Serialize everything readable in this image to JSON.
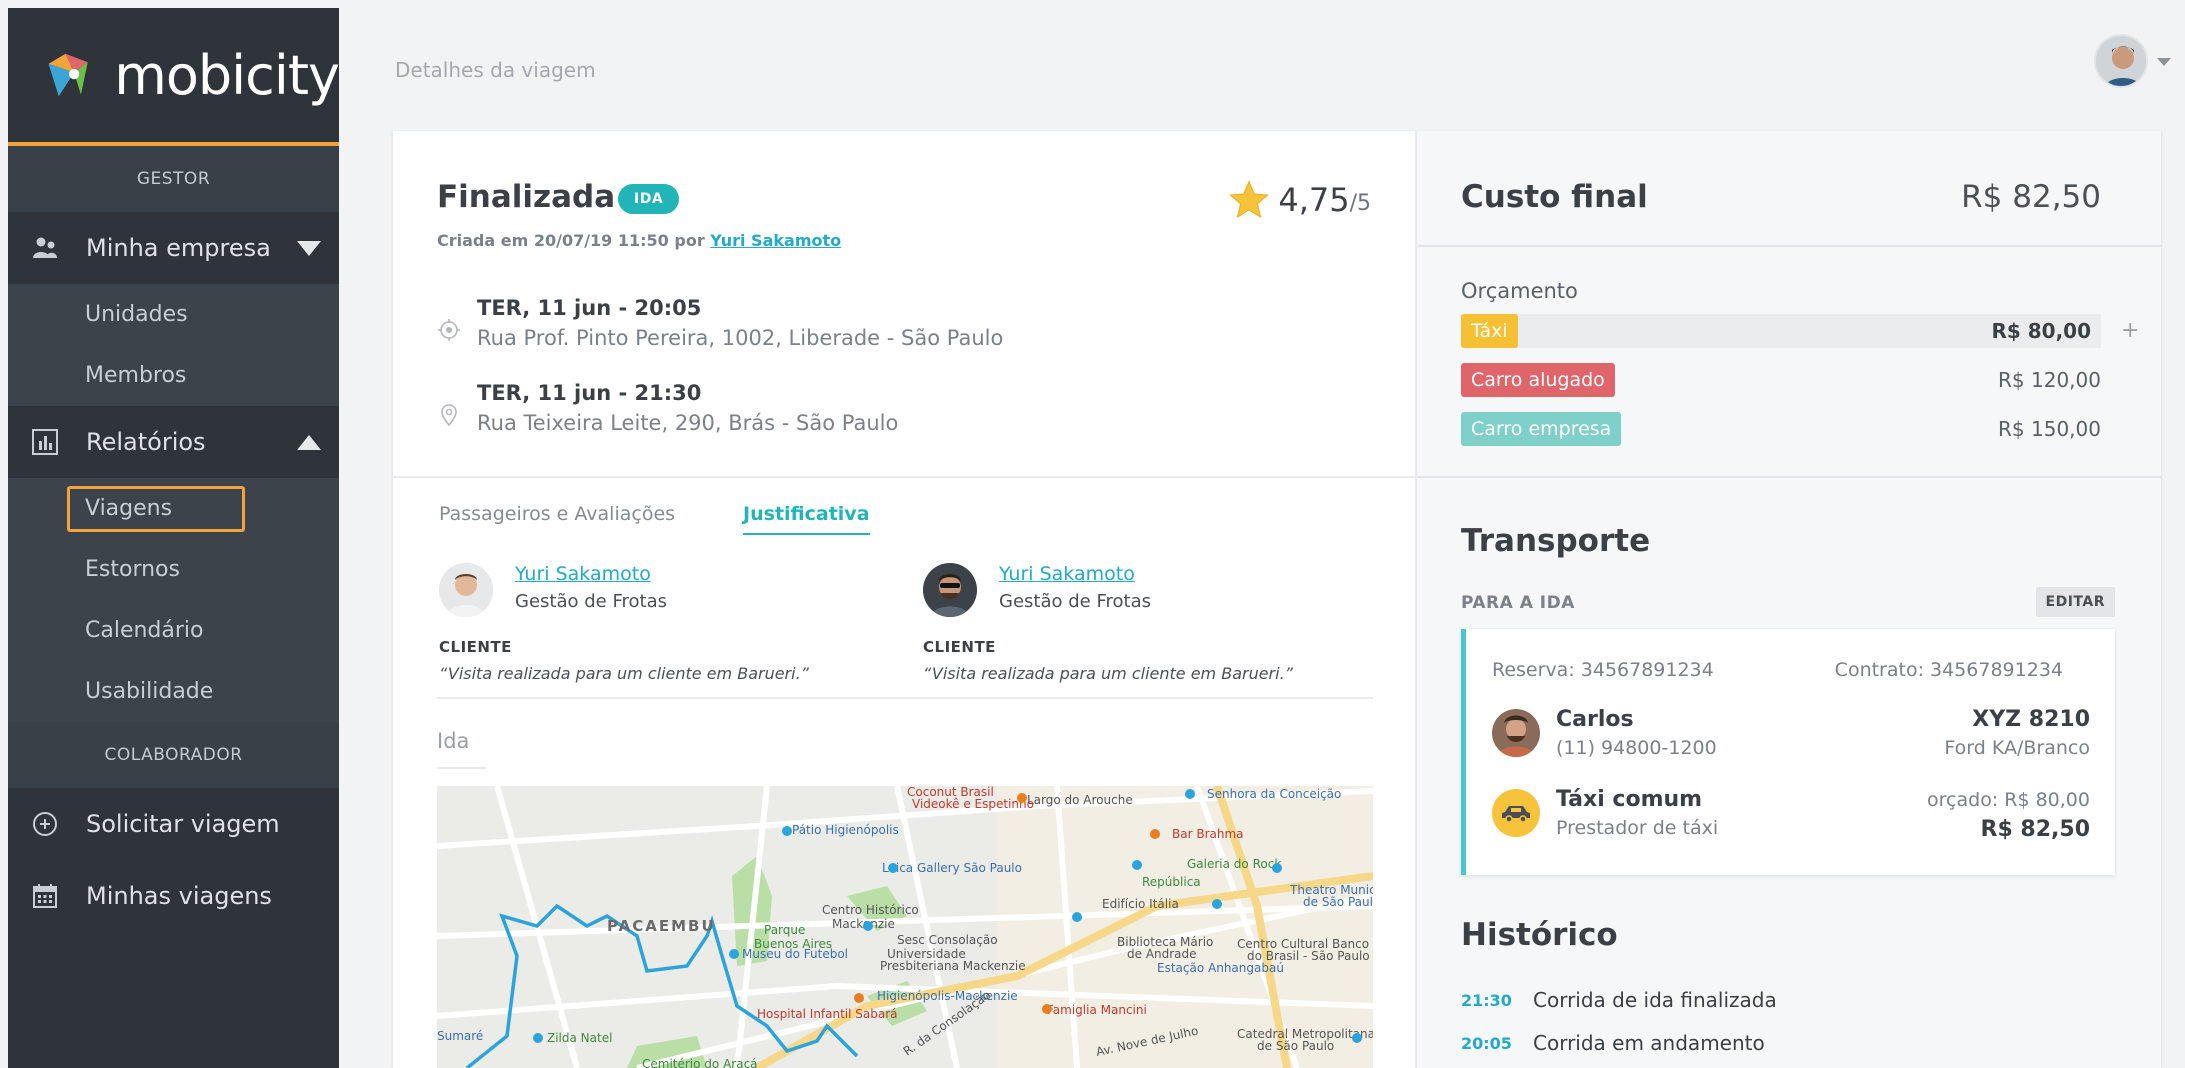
{
  "app": {
    "logo_text": "mobicity"
  },
  "sidebar": {
    "section_gestor": "GESTOR",
    "section_colaborador": "COLABORADOR",
    "empresa": {
      "label": "Minha empresa",
      "icon": "users-icon"
    },
    "empresa_items": [
      {
        "label": "Unidades"
      },
      {
        "label": "Membros"
      }
    ],
    "relatorios": {
      "label": "Relatórios",
      "icon": "chart-icon"
    },
    "relatorios_items": [
      {
        "label": "Viagens",
        "active": true
      },
      {
        "label": "Estornos"
      },
      {
        "label": "Calendário"
      },
      {
        "label": "Usabilidade"
      }
    ],
    "solicitar": {
      "label": "Solicitar viagem",
      "icon": "plus-circle-icon"
    },
    "minhas": {
      "label": "Minhas viagens",
      "icon": "calendar-icon"
    }
  },
  "header": {
    "title": "Detalhes da viagem"
  },
  "trip": {
    "status": "Finalizada",
    "badge": "IDA",
    "rating": "4,75",
    "rating_max": "/5",
    "created_prefix": "Criada em 20/07/19  11:50 por",
    "created_by": "Yuri Sakamoto",
    "origin": {
      "when": "TER, 11 jun - 20:05",
      "address": "Rua Prof. Pinto Pereira, 1002, Liberade - São Paulo"
    },
    "destination": {
      "when": "TER, 11 jun - 21:30",
      "address": "Rua Teixeira Leite, 290, Brás - São Paulo"
    },
    "tabs": [
      {
        "label": "Passageiros e Avaliações",
        "active": false
      },
      {
        "label": "Justificativa",
        "active": true
      }
    ],
    "passengers": [
      {
        "name": "Yuri Sakamoto",
        "role": "Gestão de Frotas",
        "client_label": "CLIENTE",
        "justification": "“Visita realizada para um cliente em Barueri.”"
      },
      {
        "name": "Yuri Sakamoto",
        "role": "Gestão de Frotas",
        "client_label": "CLIENTE",
        "justification": "“Visita realizada para um cliente em Barueri.”"
      }
    ],
    "route_label": "Ida",
    "map_labels": [
      "PACAEMBU",
      "Pátio Higienópolis",
      "Leica Gallery São Paulo",
      "Centro Histórico Mackenzie",
      "Parque Buenos Aires",
      "Museu do Futebol",
      "Sesc Consolação",
      "Universidade Presbiteriana Mackenzie",
      "Higienópolis-Mackenzie",
      "Hospital Infantil Sabará",
      "Cemitério do Araçá",
      "Zilda Natel",
      "Largo do Arouche",
      "Coconut Brasil Videokê e Espetinho",
      "Senhora da Conceição",
      "Bar Brahma",
      "Galeria do Rock",
      "República",
      "Theatro Municipal de São Paulo",
      "Edifício Itália",
      "Biblioteca Mário de Andrade",
      "Centro Cultural Banco do Brasil - São Paulo",
      "Estação Anhangabaú",
      "Famiglia Mancini",
      "Catedral Metropolitana de São Paulo",
      "Sumaré",
      "Av. Nove de Julho",
      "R. da Consolação"
    ]
  },
  "cost": {
    "title": "Custo final",
    "value": "R$ 82,50",
    "budget_label": "Orçamento",
    "budget": [
      {
        "tag": "Táxi",
        "amount": "R$ 80,00",
        "color": "#f5c033",
        "highlight": true
      },
      {
        "tag": "Carro alugado",
        "amount": "R$ 120,00",
        "color": "#e0656b",
        "highlight": false
      },
      {
        "tag": "Carro empresa",
        "amount": "R$ 150,00",
        "color": "#7fcfca",
        "highlight": false
      }
    ],
    "add_symbol": "+"
  },
  "transport": {
    "title": "Transporte",
    "leg_label": "PARA A IDA",
    "edit_label": "EDITAR",
    "reserva": "Reserva: 34567891234",
    "contrato": "Contrato: 34567891234",
    "driver_name": "Carlos",
    "driver_phone": "(11) 94800-1200",
    "plate": "XYZ 8210",
    "car": "Ford KA/Branco",
    "service": "Táxi comum",
    "provider": "Prestador de táxi",
    "budgeted": "orçado: R$ 80,00",
    "final": "R$ 82,50",
    "accent": "#4bc8cf"
  },
  "history": {
    "title": "Histórico",
    "events": [
      {
        "time": "21:30",
        "desc": "Corrida de ida finalizada"
      },
      {
        "time": "20:05",
        "desc": "Corrida em andamento"
      }
    ]
  }
}
